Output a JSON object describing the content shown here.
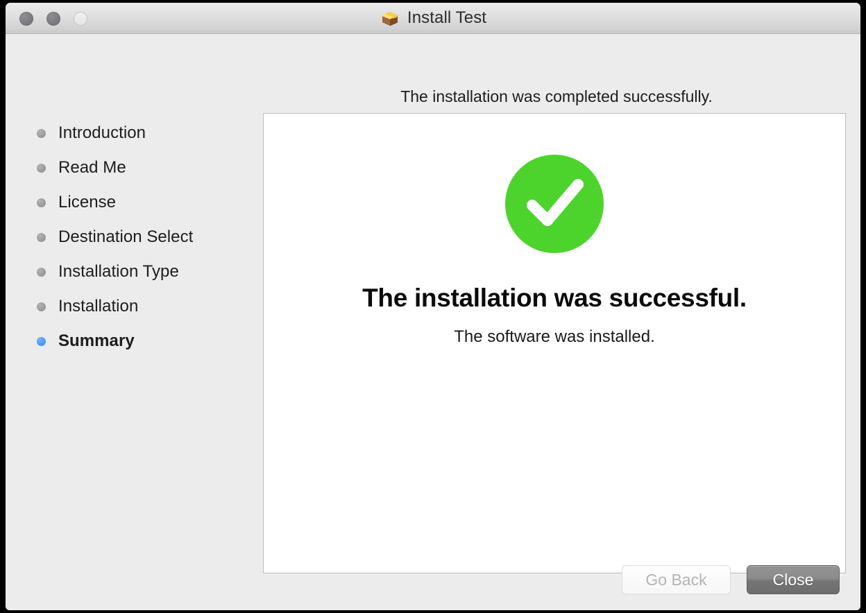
{
  "window": {
    "title": "Install Test",
    "title_icon": "package-box-icon",
    "traffic_lights": {
      "close_label": "close",
      "minimize_label": "minimize",
      "zoom_label": "zoom"
    }
  },
  "sidebar": {
    "items": [
      {
        "label": "Introduction",
        "active": false
      },
      {
        "label": "Read Me",
        "active": false
      },
      {
        "label": "License",
        "active": false
      },
      {
        "label": "Destination Select",
        "active": false
      },
      {
        "label": "Installation Type",
        "active": false
      },
      {
        "label": "Installation",
        "active": false
      },
      {
        "label": "Summary",
        "active": true
      }
    ]
  },
  "main": {
    "headline": "The installation was completed successfully.",
    "status_icon": "green-check-circle-icon",
    "success_title": "The installation was successful.",
    "success_subtitle": "The software was installed."
  },
  "footer": {
    "go_back_label": "Go Back",
    "close_label": "Close"
  },
  "colors": {
    "success_green": "#4CD32C",
    "active_step_blue": "#4a9bf5",
    "inactive_step_gray": "#9b9b9b",
    "window_background": "#ececec",
    "panel_background": "#ffffff",
    "default_button_gray": "#7d7d7d"
  }
}
